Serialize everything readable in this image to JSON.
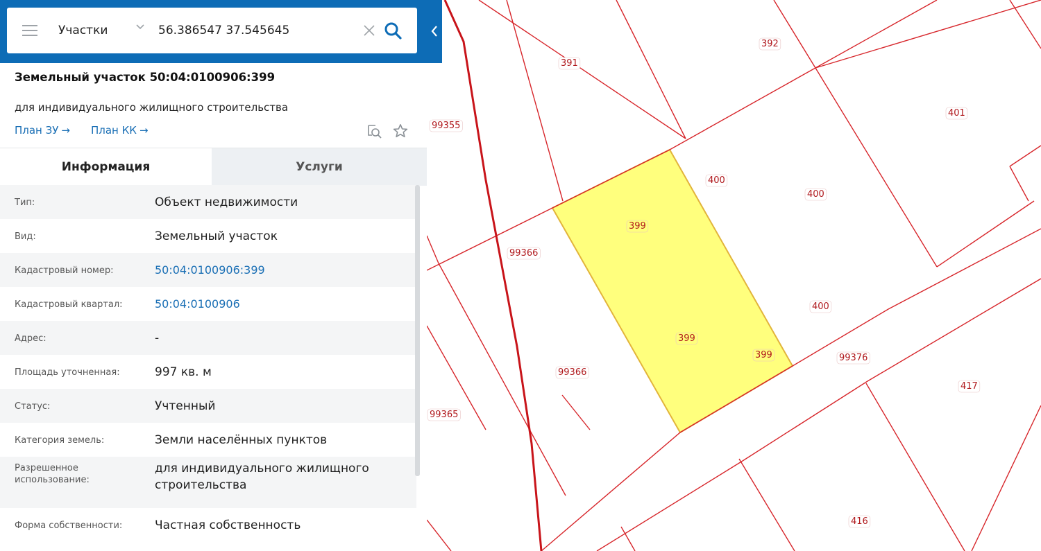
{
  "search": {
    "layer": "Участки",
    "query": "56.386547 37.545645"
  },
  "parcel": {
    "title": "Земельный участок 50:04:0100906:399",
    "subtitle": "для индивидуального жилищного строительства",
    "links": [
      {
        "label": "План ЗУ",
        "arrow": "→"
      },
      {
        "label": "План КК",
        "arrow": "→"
      }
    ]
  },
  "tabs": [
    {
      "label": "Информация",
      "active": true
    },
    {
      "label": "Услуги",
      "active": false
    }
  ],
  "info_rows": [
    {
      "label": "Тип:",
      "value": "Объект недвижимости"
    },
    {
      "label": "Вид:",
      "value": "Земельный участок"
    },
    {
      "label": "Кадастровый номер:",
      "value": "50:04:0100906:399"
    },
    {
      "label": "Кадастровый квартал:",
      "value": "50:04:0100906"
    },
    {
      "label": "Адрес:",
      "value": "-"
    },
    {
      "label": "Площадь уточненная:",
      "value": "997 кв. м"
    },
    {
      "label": "Статус:",
      "value": "Учтенный"
    },
    {
      "label": "Категория земель:",
      "value": "Земли населённых пунктов"
    },
    {
      "label": "Разрешенное использование:",
      "value": "для индивидуального жилищного строительства"
    },
    {
      "label": "Форма собственности:",
      "value": "Частная собственность"
    }
  ],
  "map": {
    "labels": [
      "391",
      "392",
      "401",
      "99355",
      "400",
      "400",
      "399",
      "99366",
      "400",
      "399",
      "399",
      "99376",
      "99366",
      "417",
      "99365",
      "416"
    ],
    "colors": {
      "boundary": "#d7262b",
      "highlight_fill": "#ffff7d",
      "highlight_stroke": "#e2b43b",
      "label": "#b0181c"
    }
  },
  "icons": [
    "menu-icon",
    "chevron-down-icon",
    "clear-icon",
    "search-icon",
    "collapse-chevron-icon",
    "find-on-map-icon",
    "star-icon"
  ]
}
